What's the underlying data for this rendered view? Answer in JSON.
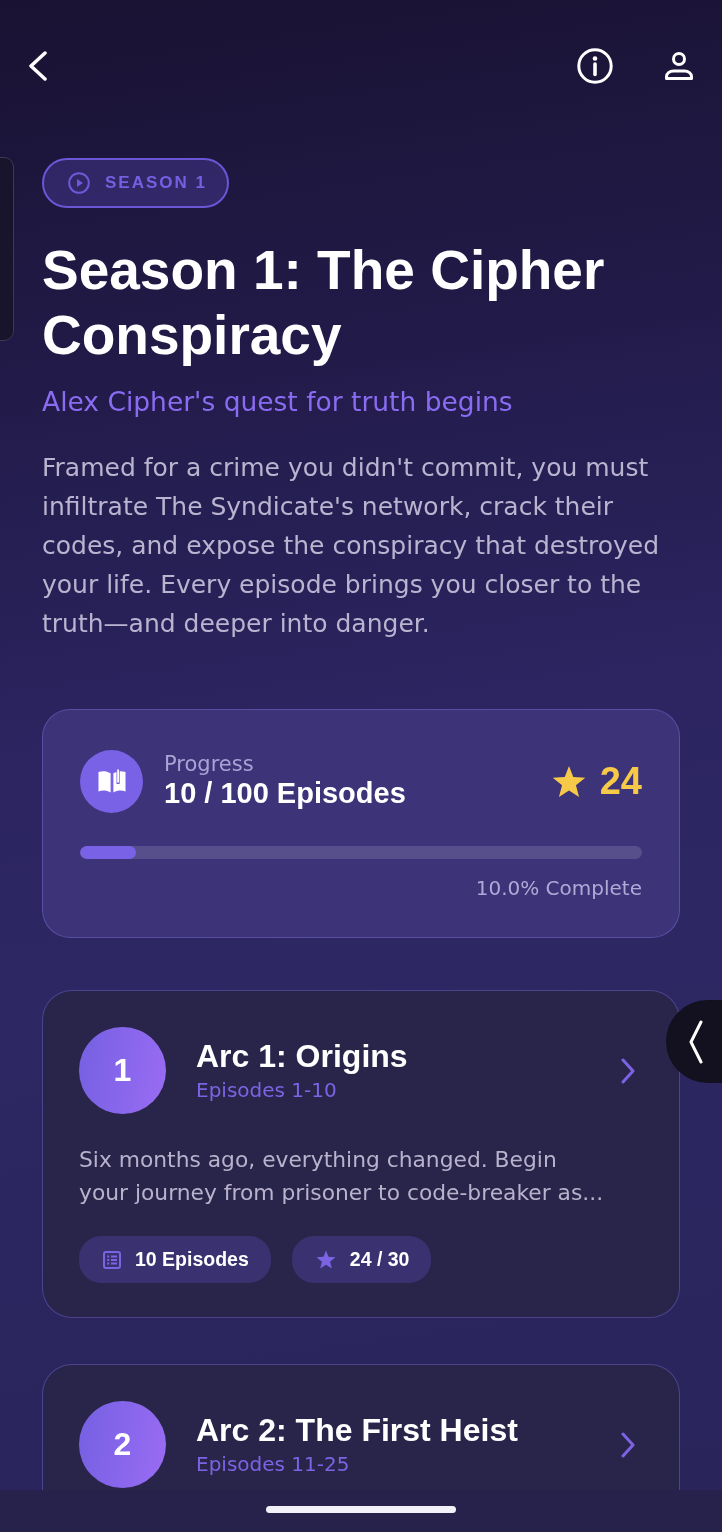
{
  "season_badge": {
    "label": "SEASON 1"
  },
  "title": "Season 1: The Cipher Conspiracy",
  "tagline": "Alex Cipher's quest for truth begins",
  "description": "Framed for a crime you didn't commit, you must infiltrate The Syndicate's network, crack their codes, and expose the conspiracy that destroyed your life. Every episode brings you closer to the truth—and deeper into danger.",
  "progress": {
    "label": "Progress",
    "count": "10 / 100 Episodes",
    "star_total": "24",
    "level": 0.1,
    "percent_text": "10.0% Complete"
  },
  "arcs": [
    {
      "number": "1",
      "title": "Arc 1: Origins",
      "episodes": "Episodes 1-10",
      "description": "Six months ago, everything changed. Begin your journey from prisoner to code-breaker as...",
      "chips": [
        {
          "kind": "episodes",
          "text": "10 Episodes"
        },
        {
          "kind": "stars",
          "text": "24 / 30"
        }
      ]
    },
    {
      "number": "2",
      "title": "Arc 2: The First Heist",
      "episodes": "Episodes 11-25"
    }
  ]
}
